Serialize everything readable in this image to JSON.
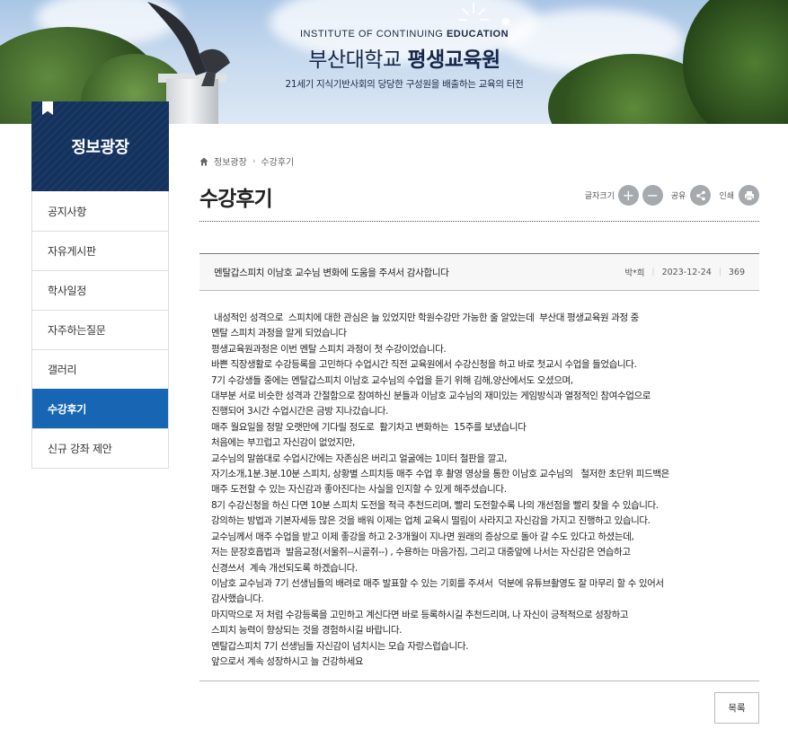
{
  "banner": {
    "eng_prefix": "INSTITUTE OF CONTINUING ",
    "eng_bold": "EDUCATION",
    "title_regular": "부산대학교 ",
    "title_bold": "평생교육원",
    "subtitle": "21세기 지식기반사회의 당당한 구성원을 배출하는 교육의 터전"
  },
  "sidebar": {
    "heading": "정보광장",
    "items": [
      {
        "label": "공지사항",
        "active": false
      },
      {
        "label": "자유게시판",
        "active": false
      },
      {
        "label": "학사일정",
        "active": false
      },
      {
        "label": "자주하는질문",
        "active": false
      },
      {
        "label": "갤러리",
        "active": false
      },
      {
        "label": "수강후기",
        "active": true
      },
      {
        "label": "신규 강좌 제안",
        "active": false
      }
    ]
  },
  "breadcrumb": {
    "home_icon": "home-icon",
    "items": [
      "정보광장",
      "수강후기"
    ]
  },
  "page": {
    "title": "수강후기"
  },
  "tools": {
    "font_size_label": "글자크기",
    "zoom_in": "+",
    "zoom_out": "−",
    "share_label": "공유",
    "print_label": "인쇄"
  },
  "post": {
    "title": "멘탈갑스피치 이남호 교수님 변화에 도움을 주셔서 감사합니다",
    "author": "박*희",
    "date": "2023-12-24",
    "views": "369",
    "body": " 내성적인 성격으로  스피치에 대한 관심은 늘 있었지만 학원수강만 가능한 줄 알았는데  부산대 평생교육원 과정 중\n멘탈 스피치 과정을 알게 되었습니다\n평생교육원과정은 이번 멘탈 스피치 과정이 첫 수강이었습니다.\n바쁜 직장생활로 수강등록을 고민하다 수업시간 직전 교육원에서 수강신청을 하고 바로 첫교시 수업을 들었습니다.\n7기 수강생들 중에는 멘탈갑스피치 이남호 교수님의 수업을 듣기 위해 김해,양산에서도 오셨으며,\n대부분 서로 비슷한 성격과 간절함으로 참여하신 분들과 이남호 교수님의 재미있는 게임방식과 열정적인 참여수업으로\n진행되어 3시간 수업시간은 금방 지나갔습니다.\n매주 월요일을 정말 오랫만에 기다릴 정도로  활기차고 변화하는  15주를 보냈습니다\n처음에는 부끄럽고 자신감이 없었지만,\n교수님의 말씀대로 수업시간에는 자존심은 버리고 얼굴에는 1미터 철판을 깔고,\n자기소개,1분.3분.10분 스피치, 상황별 스피치등 매주 수업 후 촬영 영상을 통한 이남호 교수님의   철저한 초단위 피드백은\n매주 도전할 수 있는 자신감과 좋아진다는 사실을 인지할 수 있게 해주셨습니다.\n8기 수강신청을 하신 다면 10분 스피치 도전을 적극 추천드리며, 빨리 도전할수록 나의 개선점을 빨리 찾을 수 있습니다.\n강의하는 방법과 기본자세등 많은 것을 배워 이제는 업체 교육시 떨림이 사라지고 자신감을 가지고 진행하고 있습니다.\n교수님께서 매주 수업을 받고 이제 좋강을 하고 2-3개월이 지나면 원래의 증상으로 돌아 갈 수도 있다고 하셨는데,\n저는 문장호흡법과  발음교정(서울쥐--시골쥐--) , 수용하는 마음가짐, 그리고 대중앞에 나서는 자신감은 연습하고\n신경쓰서  계속 개선되도록 하겠습니다.\n이남호 교수님과 7기 선생님들의 배려로 매주 발표할 수 있는 기회를 주셔서  덕분에 유튜브촬영도 잘 마무리 할 수 있어서\n감사했습니다.\n마지막으로 저 처럼 수강등록을 고민하고 계신다면 바로 등록하시길 추천드리며, 나 자신이 긍적적으로 성장하고\n스피치 능력이 향상되는 것을 경험하시길 바랍니다.\n멘탈갑스피치 7기 선생님들 자신감이 넘치시는 모습 자랑스럽습니다.\n앞으로서 계속 성장하시고 늘 건강하세요"
  },
  "list_button": "목록",
  "colors": {
    "sidebar_head": "#14325e",
    "active_item": "#1766b4",
    "tool_button": "#a6a9ad"
  }
}
